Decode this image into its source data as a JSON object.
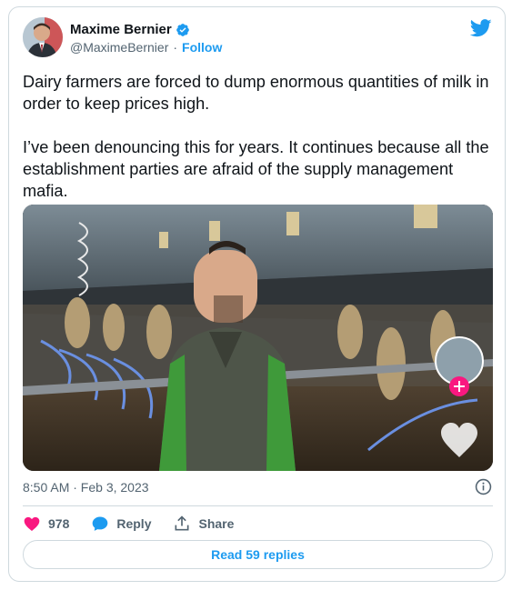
{
  "author": {
    "name": "Maxime Bernier",
    "handle": "@MaximeBernier",
    "separator": "·",
    "follow_label": "Follow"
  },
  "tweet": {
    "text": "Dairy farmers are forced to dump enormous quantities of milk in order to keep prices high.\n\nI’ve been denouncing this for years. It continues because all the establishment parties are afraid of the supply management mafia.",
    "timestamp": "8:50 AM · Feb 3, 2023"
  },
  "actions": {
    "likes": "978",
    "reply_label": "Reply",
    "share_label": "Share"
  },
  "read_replies_label": "Read 59 replies",
  "icons": [
    "verified-icon",
    "twitter-bird-icon",
    "info-icon",
    "heart-icon",
    "reply-icon",
    "share-icon"
  ],
  "colors": {
    "accent": "#1d9bf0",
    "like": "#f91880",
    "secondary_text": "#536471",
    "border": "#cfd9de"
  }
}
